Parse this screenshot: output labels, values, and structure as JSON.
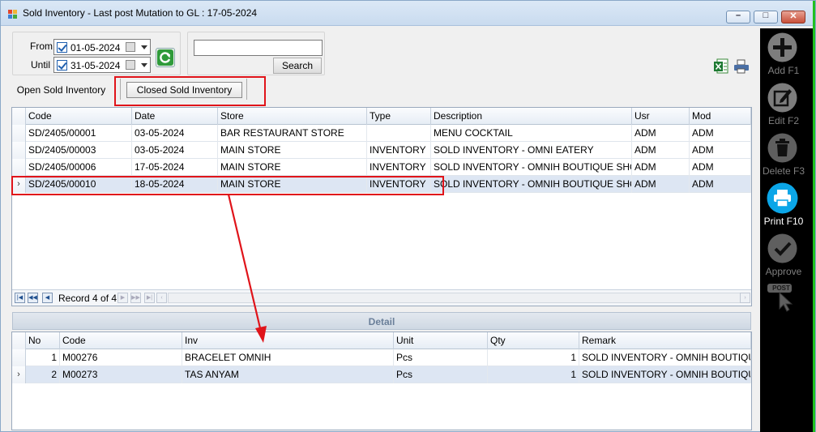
{
  "window": {
    "title": "Sold Inventory - Last post Mutation to GL : 17-05-2024",
    "minimize_symbol": "–",
    "maximize_symbol": "□",
    "close_symbol": "✕"
  },
  "filter": {
    "from_label": "From",
    "from_value": "01-05-2024",
    "until_label": "Until",
    "until_value": "31-05-2024",
    "search_value": "",
    "search_button": "Search"
  },
  "tabs": {
    "open": "Open Sold Inventory",
    "closed": "Closed Sold Inventory"
  },
  "main_grid": {
    "columns": [
      "Code",
      "Date",
      "Store",
      "Type",
      "Description",
      "Usr",
      "Mod"
    ],
    "rows": [
      [
        "SD/2405/00001",
        "03-05-2024",
        "BAR RESTAURANT STORE",
        "",
        "MENU COCKTAIL",
        "ADM",
        "ADM"
      ],
      [
        "SD/2405/00003",
        "03-05-2024",
        "MAIN STORE",
        "INVENTORY",
        "SOLD INVENTORY - OMNI EATERY",
        "ADM",
        "ADM"
      ],
      [
        "SD/2405/00006",
        "17-05-2024",
        "MAIN STORE",
        "INVENTORY",
        "SOLD INVENTORY - OMNIH BOUTIQUE SHOP",
        "ADM",
        "ADM"
      ],
      [
        "SD/2405/00010",
        "18-05-2024",
        "MAIN STORE",
        "INVENTORY",
        "SOLD INVENTORY - OMNIH BOUTIQUE SHOP",
        "ADM",
        "ADM"
      ]
    ],
    "selected_row_index": 3,
    "record_text": "Record 4 of 4"
  },
  "detail": {
    "title": "Detail",
    "columns": [
      "No",
      "Code",
      "Inv",
      "Unit",
      "Qty",
      "Remark"
    ],
    "rows": [
      [
        "1",
        "M00276",
        "BRACELET OMNIH",
        "Pcs",
        "1",
        "SOLD INVENTORY - OMNIH BOUTIQUE S..."
      ],
      [
        "2",
        "M00273",
        "TAS ANYAM",
        "Pcs",
        "1",
        "SOLD INVENTORY - OMNIH BOUTIQUE S..."
      ]
    ],
    "selected_row_index": 1
  },
  "toolbar": {
    "add": "Add F1",
    "edit": "Edit F2",
    "delete": "Delete F3",
    "print": "Print F10",
    "approve": "Approve",
    "post": "POST"
  },
  "colors": {
    "highlight": "#e0141a",
    "print_active": "#0ba6e8",
    "toolbar_bg": "#000000"
  }
}
